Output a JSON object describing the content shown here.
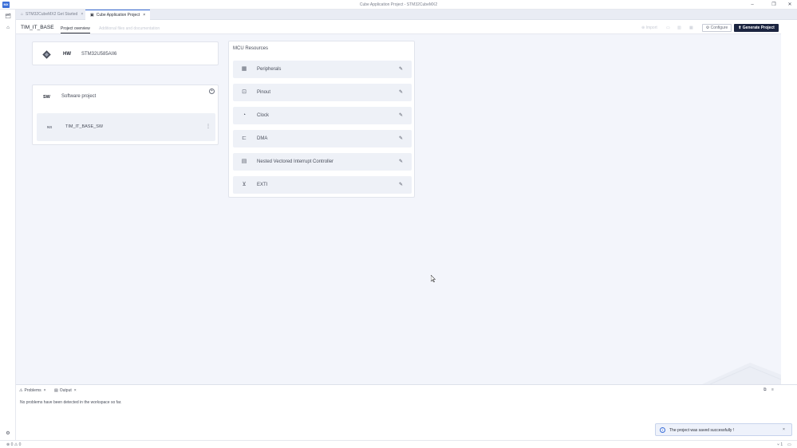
{
  "window": {
    "logo_text": "MX",
    "title": "Cube Application Project - STM32CubeMX2",
    "minimize": "–",
    "restore": "❐",
    "close": "✕"
  },
  "activity_bar": {
    "items": [
      {
        "name": "projects",
        "icon": "🗂"
      },
      {
        "name": "home",
        "icon": "⌂"
      }
    ],
    "settings_icon": "⚙"
  },
  "tabs": [
    {
      "label": "STM32CubeMX2 Get Started",
      "icon": "⌂",
      "close": "×",
      "active": false
    },
    {
      "label": "Cube Application Project",
      "icon": "▣",
      "close": "×",
      "active": true
    }
  ],
  "header": {
    "project_name": "TIM_IT_BASE",
    "subtabs": [
      {
        "label": "Project overview",
        "active": true
      },
      {
        "label": "Additional files and documentation",
        "active": false
      }
    ],
    "import_label": "⊕ Import",
    "configure_label": "⚙ Configure",
    "generate_label": "⬆ Generate Project"
  },
  "hw_card": {
    "label": "HW",
    "value": "STM32U585AII6"
  },
  "sw_card": {
    "label": "SW",
    "title": "Software project",
    "add_icon": "+",
    "project": {
      "ns": "NS",
      "name": "TIM_IT_BASE_SW",
      "menu": "⋮"
    }
  },
  "mcu_resources": {
    "title": "MCU Resources",
    "items": [
      {
        "label": "Peripherals",
        "icon": "▦"
      },
      {
        "label": "Pinout",
        "icon": "⊡"
      },
      {
        "label": "Clock",
        "icon": "◔"
      },
      {
        "label": "DMA",
        "icon": "⊏"
      },
      {
        "label": "Nested Vectored Interrupt Controller",
        "icon": "▤"
      },
      {
        "label": "EXTI",
        "icon": "⊻"
      }
    ],
    "edit_icon": "✎"
  },
  "panel": {
    "tabs": [
      {
        "label": "Problems",
        "icon": "⚠",
        "close": "×"
      },
      {
        "label": "Output",
        "icon": "▤",
        "close": "×"
      }
    ],
    "message": "No problems have been detected in the workspace so far.",
    "actions": [
      "⧉",
      "≡"
    ]
  },
  "toast": {
    "icon": "i",
    "message": "The project was saved successfully !",
    "close": "×"
  },
  "status_bar": {
    "left": "⊗ 0  ⚠ 0",
    "right": [
      "⑂ 1",
      "▭"
    ]
  },
  "colors": {
    "accent": "#3b6fd8",
    "primary_button": "#1b2440",
    "background": "#f3f5fb",
    "card": "#ffffff",
    "row": "#eef1f7"
  }
}
